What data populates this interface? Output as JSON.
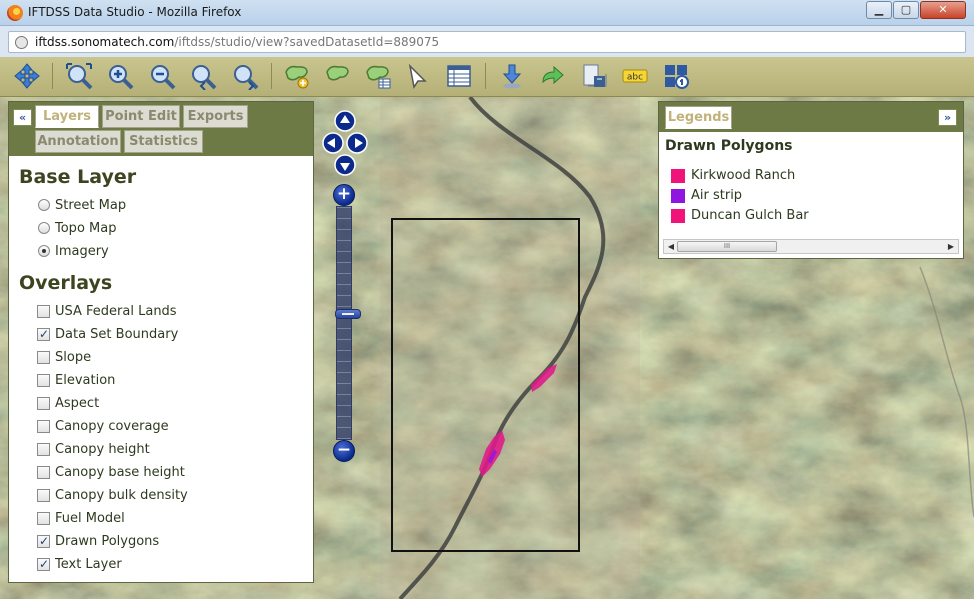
{
  "window": {
    "title": "IFTDSS Data Studio - Mozilla Firefox",
    "min_label": "▁",
    "max_label": "▢",
    "close_label": "✕"
  },
  "address": {
    "url_host": "iftdss.sonomatech.com",
    "url_path": "/iftdss/studio/view?savedDatasetId=889075"
  },
  "toolbar": {
    "tools": [
      "pan-icon",
      "zoom-extent-icon",
      "zoom-in-icon",
      "zoom-out-icon",
      "zoom-previous-icon",
      "zoom-next-icon",
      "add-polygon-icon",
      "edit-polygon-icon",
      "polygon-table-icon",
      "select-pointer-icon",
      "data-table-icon",
      "import-icon",
      "export-icon",
      "save-icon",
      "label-icon",
      "identify-icon"
    ],
    "label_text": "abc"
  },
  "left_panel": {
    "collapse_label": "«",
    "tabs": [
      "Layers",
      "Point Edit",
      "Exports",
      "Annotation",
      "Statistics"
    ],
    "active_tab": "Layers",
    "base_layer_title": "Base Layer",
    "base_layers": [
      {
        "label": "Street Map",
        "selected": false
      },
      {
        "label": "Topo Map",
        "selected": false
      },
      {
        "label": "Imagery",
        "selected": true
      }
    ],
    "overlays_title": "Overlays",
    "overlays": [
      {
        "label": "USA Federal Lands",
        "checked": false
      },
      {
        "label": "Data Set Boundary",
        "checked": true
      },
      {
        "label": "Slope",
        "checked": false
      },
      {
        "label": "Elevation",
        "checked": false
      },
      {
        "label": "Aspect",
        "checked": false
      },
      {
        "label": "Canopy coverage",
        "checked": false
      },
      {
        "label": "Canopy height",
        "checked": false
      },
      {
        "label": "Canopy base height",
        "checked": false
      },
      {
        "label": "Canopy bulk density",
        "checked": false
      },
      {
        "label": "Fuel Model",
        "checked": false
      },
      {
        "label": "Drawn Polygons",
        "checked": true
      },
      {
        "label": "Text Layer",
        "checked": true
      }
    ]
  },
  "legend_panel": {
    "tab": "Legends",
    "expand_label": "»",
    "title": "Drawn Polygons",
    "items": [
      {
        "label": "Kirkwood Ranch",
        "color": "#f0137a"
      },
      {
        "label": "Air strip",
        "color": "#8f16e0"
      },
      {
        "label": "Duncan Gulch Bar",
        "color": "#f0137a"
      }
    ],
    "scroll_left": "◀",
    "scroll_right": "▶",
    "scroll_thumb": "III"
  },
  "map": {
    "zoom_in_label": "+",
    "zoom_out_label": "−",
    "zoom_level_fraction": 0.46,
    "accent_navy": "#0b2a8c",
    "polygon_color": "#e0188a"
  }
}
